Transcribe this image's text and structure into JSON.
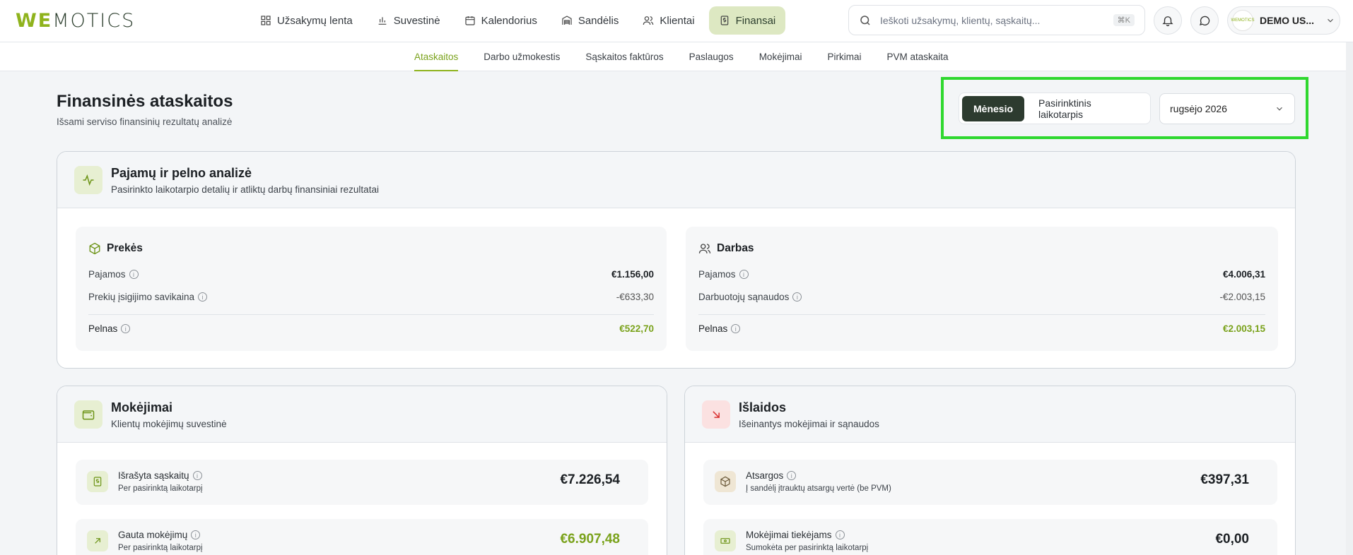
{
  "logo": {
    "part_a": "WE",
    "part_b": "MOTICS"
  },
  "nav": [
    {
      "label": "Užsakymų lenta",
      "icon": "grid-icon"
    },
    {
      "label": "Suvestinė",
      "icon": "bar-chart-icon"
    },
    {
      "label": "Kalendorius",
      "icon": "calendar-icon"
    },
    {
      "label": "Sandėlis",
      "icon": "warehouse-icon"
    },
    {
      "label": "Klientai",
      "icon": "users-icon"
    },
    {
      "label": "Finansai",
      "icon": "dollar-file-icon",
      "active": true
    }
  ],
  "search": {
    "placeholder": "Ieškoti užsakymų, klientų, sąskaitų...",
    "shortcut": "⌘K"
  },
  "user": {
    "name": "DEMO US...",
    "avatar_text": "WEMOTICS"
  },
  "subnav": [
    {
      "label": "Ataskaitos",
      "active": true
    },
    {
      "label": "Darbo užmokestis"
    },
    {
      "label": "Sąskaitos faktūros"
    },
    {
      "label": "Paslaugos"
    },
    {
      "label": "Mokėjimai"
    },
    {
      "label": "Pirkimai"
    },
    {
      "label": "PVM ataskaita"
    }
  ],
  "header": {
    "title": "Finansinės ataskaitos",
    "subtitle": "Išsami serviso finansinių rezultatų analizė"
  },
  "period": {
    "month_label": "Mėnesio",
    "custom_label": "Pasirinktinis laikotarpis",
    "selected_month": "rugsėjo 2026"
  },
  "analysis": {
    "title": "Pajamų ir pelno analizė",
    "subtitle": "Pasirinkto laikotarpio detalių ir atliktų darbų finansiniai rezultatai",
    "goods": {
      "title": "Prekės",
      "income_label": "Pajamos",
      "income": "€1.156,00",
      "cost_label": "Prekių įsigijimo savikaina",
      "cost": "-€633,30",
      "profit_label": "Pelnas",
      "profit": "€522,70"
    },
    "work": {
      "title": "Darbas",
      "income_label": "Pajamos",
      "income": "€4.006,31",
      "cost_label": "Darbuotojų sąnaudos",
      "cost": "-€2.003,15",
      "profit_label": "Pelnas",
      "profit": "€2.003,15"
    }
  },
  "payments": {
    "title": "Mokėjimai",
    "subtitle": "Klientų mokėjimų suvestinė",
    "items": [
      {
        "title": "Išrašyta sąskaitų",
        "sub": "Per pasirinktą laikotarpį",
        "value": "€7.226,54"
      },
      {
        "title": "Gauta mokėjimų",
        "sub": "Per pasirinktą laikotarpį",
        "value": "€6.907,48"
      }
    ]
  },
  "expenses": {
    "title": "Išlaidos",
    "subtitle": "Išeinantys mokėjimai ir sąnaudos",
    "items": [
      {
        "title": "Atsargos",
        "sub": "Į sandėlį įtrauktų atsargų vertė (be PVM)",
        "value": "€397,31"
      },
      {
        "title": "Mokėjimai tiekėjams",
        "sub": "Sumokėta per pasirinktą laikotarpį",
        "value": "€0,00"
      }
    ]
  },
  "colors": {
    "accent": "#8fb31d",
    "dark": "#2d3b2f",
    "highlight": "#2fd82f"
  }
}
